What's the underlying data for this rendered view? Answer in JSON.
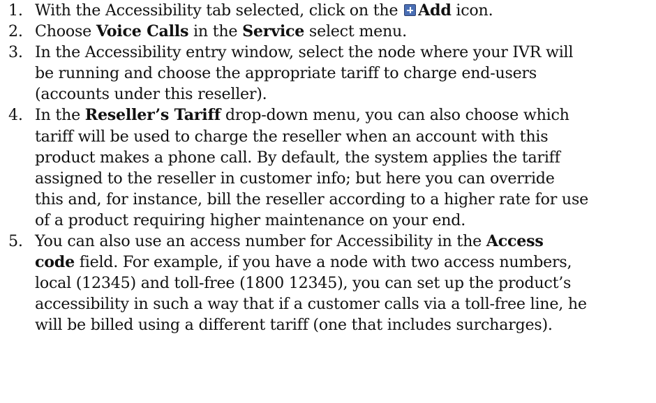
{
  "steps": [
    {
      "number": "1.",
      "lines": [
        [
          {
            "text": "With the Accessibility tab selected, click on the "
          },
          {
            "icon": "add-icon"
          },
          {
            "text": "Add",
            "bold": true
          },
          {
            "text": " icon."
          }
        ]
      ]
    },
    {
      "number": "2.",
      "lines": [
        [
          {
            "text": "Choose "
          },
          {
            "text": "Voice Calls",
            "bold": true
          },
          {
            "text": " in the "
          },
          {
            "text": "Service",
            "bold": true
          },
          {
            "text": " select menu."
          }
        ]
      ]
    },
    {
      "number": "3.",
      "lines": [
        [
          {
            "text": "In the Accessibility entry window, select the node where your IVR will"
          }
        ],
        [
          {
            "text": "be running and choose the appropriate tariff to charge end-users"
          }
        ],
        [
          {
            "text": "(accounts under this reseller)."
          }
        ]
      ]
    },
    {
      "number": "4.",
      "lines": [
        [
          {
            "text": "In the "
          },
          {
            "text": "Reseller’s Tariff",
            "bold": true
          },
          {
            "text": " drop-down menu, you can also choose which"
          }
        ],
        [
          {
            "text": "tariff will be used to charge the reseller when an account with this"
          }
        ],
        [
          {
            "text": "product makes a phone call. By default, the system applies the tariff"
          }
        ],
        [
          {
            "text": "assigned to the reseller in customer info; but here you can override"
          }
        ],
        [
          {
            "text": "this and, for instance, bill the reseller according to a higher rate for use"
          }
        ],
        [
          {
            "text": "of a product requiring higher maintenance on your end."
          }
        ]
      ]
    },
    {
      "number": "5.",
      "lines": [
        [
          {
            "text": "You can also use an access number for Accessibility in the "
          },
          {
            "text": "Access",
            "bold": true
          }
        ],
        [
          {
            "text": "code",
            "bold": true
          },
          {
            "text": " field. For example, if you have a node with two access numbers,"
          }
        ],
        [
          {
            "text": "local (12345) and toll-free (1800 12345), you can set up the product’s"
          }
        ],
        [
          {
            "text": "accessibility in such a way that if a customer calls via a toll-free line, he"
          }
        ],
        [
          {
            "text": "will be billed using a different tariff (one that includes surcharges)."
          }
        ]
      ]
    }
  ]
}
